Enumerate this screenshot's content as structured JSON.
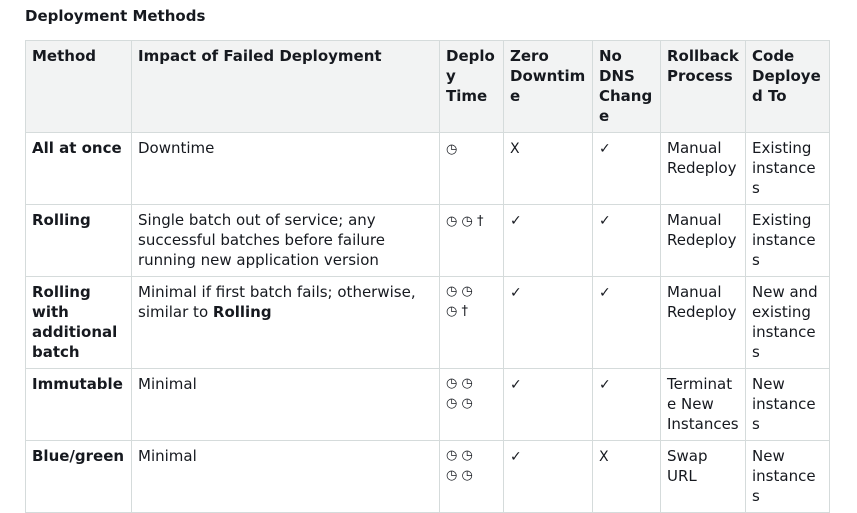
{
  "heading": "Deployment Methods",
  "table": {
    "headers": {
      "method": "Method",
      "impact": "Impact of Failed Deployment",
      "deploy_time": "Deploy Time",
      "zero_downtime": "Zero Downtime",
      "no_dns": "No DNS Change",
      "rollback": "Rollback Process",
      "code": "Code Deployed To"
    },
    "rows": [
      {
        "method": "All at once",
        "impact": "Downtime",
        "time_line1": "◷",
        "time_line2": "",
        "zero_downtime": "X",
        "no_dns": "✓",
        "rollback": "Manual Redeploy",
        "code": "Existing instances"
      },
      {
        "method": "Rolling",
        "impact": "Single batch out of service; any successful batches before failure running new application version",
        "time_line1": "◷ ◷ †",
        "time_line2": "",
        "zero_downtime": "✓",
        "no_dns": "✓",
        "rollback": "Manual Redeploy",
        "code": "Existing instances"
      },
      {
        "method": "Rolling with additional batch",
        "impact_prefix": "Minimal if first batch fails; otherwise, similar to ",
        "impact_bold": "Rolling",
        "time_line1": "◷ ◷",
        "time_line2": "◷ †",
        "zero_downtime": "✓",
        "no_dns": "✓",
        "rollback": "Manual Redeploy",
        "code": "New and existing instances"
      },
      {
        "method": "Immutable",
        "impact": "Minimal",
        "time_line1": "◷ ◷",
        "time_line2": "◷ ◷",
        "zero_downtime": "✓",
        "no_dns": "✓",
        "rollback": "Terminate New Instances",
        "code": "New instances"
      },
      {
        "method": "Blue/green",
        "impact": "Minimal",
        "time_line1": "◷ ◷",
        "time_line2": "◷ ◷",
        "zero_downtime": "✓",
        "no_dns": "X",
        "rollback": "Swap URL",
        "code": "New instances"
      }
    ]
  }
}
